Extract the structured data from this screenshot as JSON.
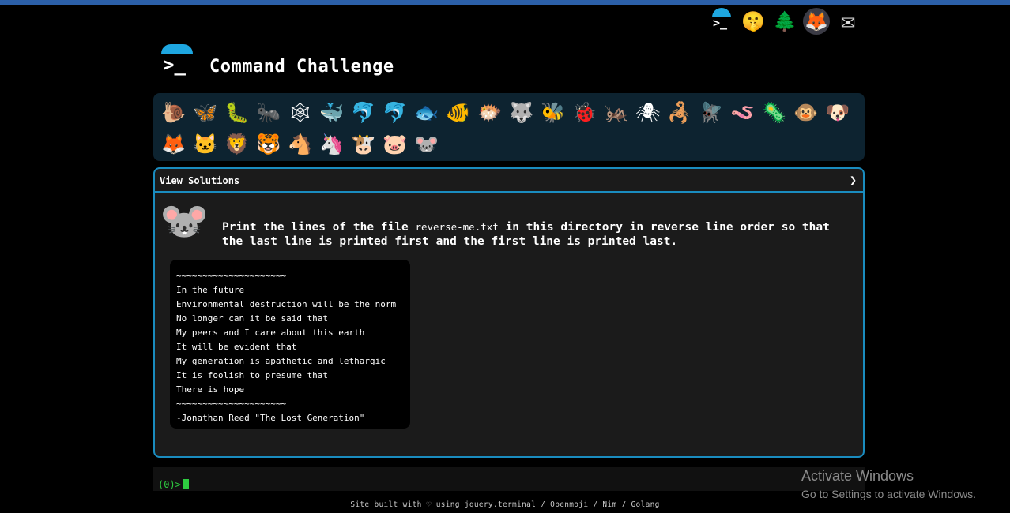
{
  "colors": {
    "accent": "#1a8cbf",
    "top_bar": "#2b5fa8",
    "prompt_green": "#2ecc40",
    "animal_panel_bg": "#0d2330"
  },
  "top_icons": [
    {
      "name": "terminal-logo-icon",
      "glyph": ">_"
    },
    {
      "name": "shushing-face-icon",
      "glyph": "🤫"
    },
    {
      "name": "evergreen-tree-icon",
      "glyph": "🌲"
    },
    {
      "name": "gitlab-icon",
      "glyph": "🦊"
    },
    {
      "name": "envelope-icon",
      "glyph": "✉"
    }
  ],
  "header": {
    "logo_prompt": ">_",
    "title": "Command Challenge"
  },
  "animals": [
    "🐌",
    "🦋",
    "🐛",
    "🐜",
    "🕸",
    "🐳",
    "🐬",
    "🐬",
    "🐟",
    "🐠",
    "🐡",
    "🐺",
    "🐝",
    "🐞",
    "🦗",
    "🕷",
    "🦂",
    "🪰",
    "🪱",
    "🦠",
    "🐵",
    "🐶",
    "🦊",
    "🐱",
    "🦁",
    "🐯",
    "🐴",
    "🦄",
    "🐮",
    "🐷",
    "🐭"
  ],
  "challenge": {
    "view_solutions": "View Solutions",
    "chevron": "❯",
    "icon": "🐭",
    "task_before": "Print the lines of the file ",
    "task_file": "reverse-me.txt",
    "task_after": " in this directory in reverse line order so that the last line is printed first and the first line is printed last.",
    "poem_lines": [
      "~~~~~~~~~~~~~~~~~~~~~",
      "In the future",
      "Environmental destruction will be the norm",
      "No longer can it be said that",
      "My peers and I care about this earth",
      "It will be evident that",
      "My generation is apathetic and lethargic",
      "It is foolish to presume that",
      "There is hope",
      "~~~~~~~~~~~~~~~~~~~~~",
      "-Jonathan Reed \"The Lost Generation\""
    ]
  },
  "terminal": {
    "prompt": "(0)>"
  },
  "footer": {
    "text": "Site built with ♡ using jquery.terminal / Openmoji / Nim / Golang"
  },
  "watermark": {
    "title": "Activate Windows",
    "subtitle": "Go to Settings to activate Windows."
  }
}
